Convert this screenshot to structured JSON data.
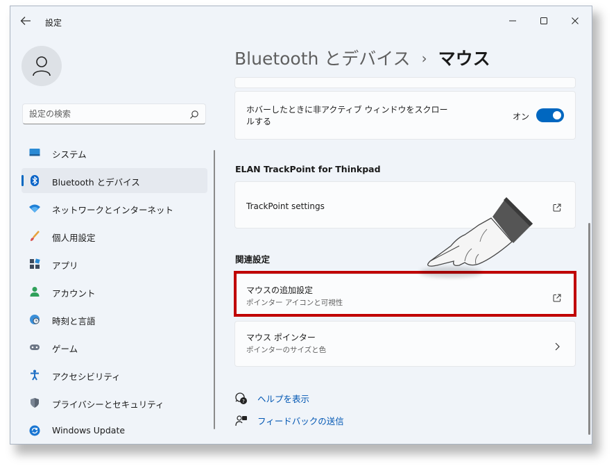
{
  "window": {
    "app_title": "設定"
  },
  "search": {
    "placeholder": "設定の検索"
  },
  "sidebar": {
    "items": [
      {
        "label": "システム",
        "icon": "system-display-icon"
      },
      {
        "label": "Bluetooth とデバイス",
        "icon": "bluetooth-icon",
        "active": true
      },
      {
        "label": "ネットワークとインターネット",
        "icon": "wifi-icon"
      },
      {
        "label": "個人用設定",
        "icon": "brush-icon"
      },
      {
        "label": "アプリ",
        "icon": "apps-icon"
      },
      {
        "label": "アカウント",
        "icon": "account-icon"
      },
      {
        "label": "時刻と言語",
        "icon": "globe-clock-icon"
      },
      {
        "label": "ゲーム",
        "icon": "gamepad-icon"
      },
      {
        "label": "アクセシビリティ",
        "icon": "accessibility-icon"
      },
      {
        "label": "プライバシーとセキュリティ",
        "icon": "shield-icon"
      },
      {
        "label": "Windows Update",
        "icon": "update-icon"
      }
    ]
  },
  "header": {
    "breadcrumb_parent": "Bluetooth とデバイス",
    "separator": "›",
    "current": "マウス"
  },
  "settings": {
    "hover_scroll": {
      "label": "ホバーしたときに非アクティブ ウィンドウをスクロールする",
      "toggle_state": "オン",
      "toggle_on": true
    },
    "elan_section": {
      "title": "ELAN TrackPoint for Thinkpad",
      "trackpoint_settings": "TrackPoint settings"
    },
    "related_section": {
      "title": "関連設定",
      "mouse_extra": {
        "title": "マウスの追加設定",
        "subtitle": "ポインター アイコンと可視性"
      },
      "mouse_pointer": {
        "title": "マウス ポインター",
        "subtitle": "ポインターのサイズと色"
      }
    },
    "links": {
      "help": "ヘルプを表示",
      "feedback": "フィードバックの送信"
    }
  },
  "colors": {
    "accent": "#0067c0",
    "highlight_box": "#c00000",
    "link": "#0056b3"
  }
}
